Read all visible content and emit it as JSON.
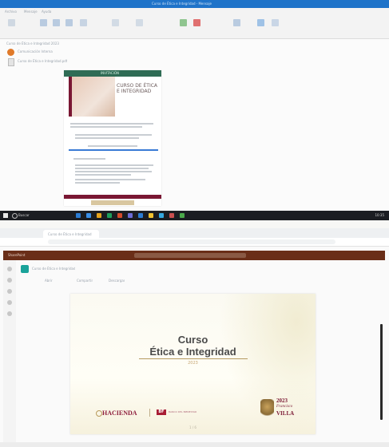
{
  "outlook": {
    "window_title": "Curso de Ética e Integridad - Mensaje",
    "ribbon_tabs": [
      "Archivo",
      "Mensaje",
      "Ayuda"
    ],
    "subject": "Curso de Ética e Integridad 2023",
    "sender_line": "Comunicación Interna",
    "attachment_line": "Curso de Ética e Integridad.pdf",
    "flyer": {
      "header_label": "INVITACIÓN",
      "title": "CURSO DE ÉTICA E INTEGRIDAD"
    },
    "taskbar": {
      "search_label": "Buscar",
      "tray_time": "10:35",
      "app_colors": [
        "#2b7cd3",
        "#3a8ee6",
        "#e5a21c",
        "#1e9e5a",
        "#d34a2b",
        "#6b6bd6",
        "#2b7cd3",
        "#f2c230",
        "#35a8e0",
        "#c94f4f",
        "#4aa84a"
      ]
    }
  },
  "browser": {
    "tab_title": "Curso de Ética e Integridad",
    "url": "",
    "app_name": "SharePoint",
    "file_name": "Curso de Ética e Integridad",
    "toolbar_actions": [
      "Abrir",
      "Compartir",
      "Descargar"
    ],
    "slide": {
      "title_line1": "Curso",
      "title_line2": "Ética e Integridad",
      "year": "2023",
      "logo_hacienda": "HACIENDA",
      "logo_bf": "BF",
      "logo_bf_sub": "BANCO DEL BIENESTAR",
      "emblem_year": "2023",
      "emblem_name": "Francisco",
      "emblem_word": "VILLA",
      "pager": "1 / 6"
    },
    "colors": {
      "app_bar": "#6a2e18",
      "accent_maroon": "#7a1733",
      "gold": "#b59a60"
    }
  }
}
